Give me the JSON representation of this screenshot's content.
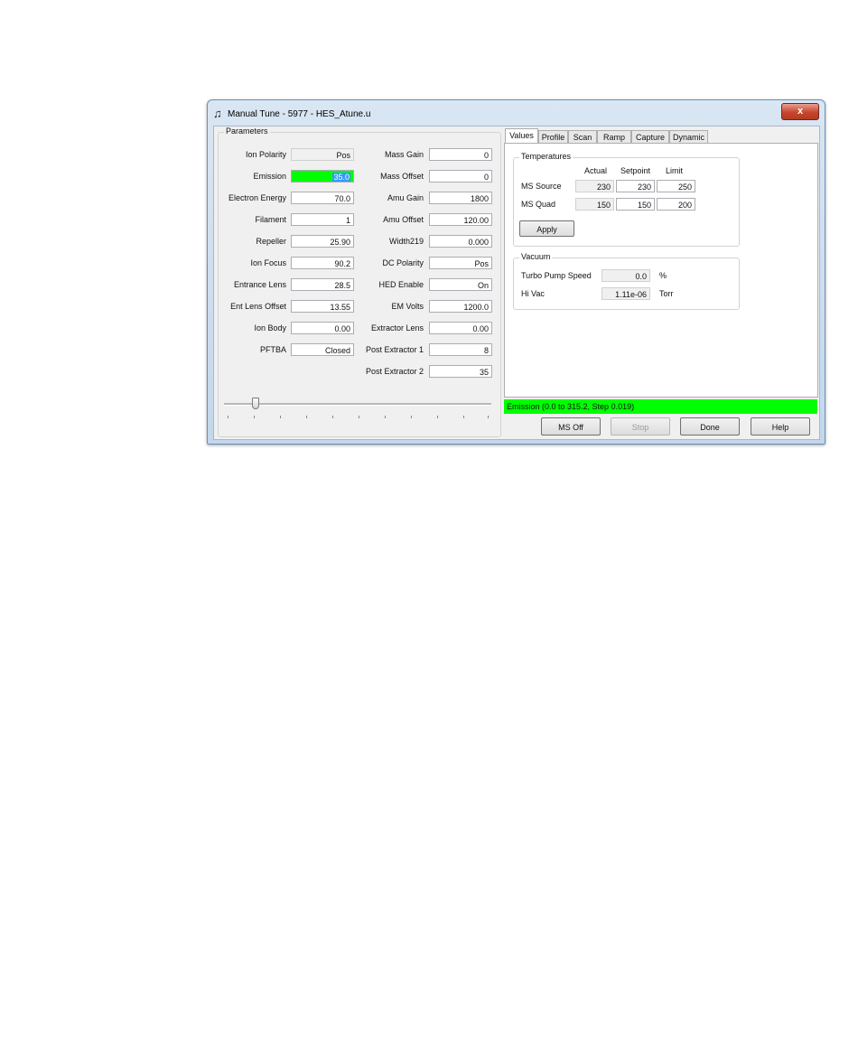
{
  "window": {
    "title": "Manual Tune - 5977 - HES_Atune.u",
    "close_glyph": "x",
    "icon": "music-note-icon"
  },
  "parameters": {
    "group_label": "Parameters",
    "left": [
      {
        "label": "Ion Polarity",
        "value": "Pos"
      },
      {
        "label": "Emission",
        "value": "35.0"
      },
      {
        "label": "Electron Energy",
        "value": "70.0"
      },
      {
        "label": "Filament",
        "value": "1"
      },
      {
        "label": "Repeller",
        "value": "25.90"
      },
      {
        "label": "Ion Focus",
        "value": "90.2"
      },
      {
        "label": "Entrance Lens",
        "value": "28.5"
      },
      {
        "label": "Ent Lens Offset",
        "value": "13.55"
      },
      {
        "label": "Ion Body",
        "value": "0.00"
      },
      {
        "label": "PFTBA",
        "value": "Closed"
      }
    ],
    "right": [
      {
        "label": "Mass Gain",
        "value": "0"
      },
      {
        "label": "Mass Offset",
        "value": "0"
      },
      {
        "label": "Amu Gain",
        "value": "1800"
      },
      {
        "label": "Amu Offset",
        "value": "120.00"
      },
      {
        "label": "Width219",
        "value": "0.000"
      },
      {
        "label": "DC Polarity",
        "value": "Pos"
      },
      {
        "label": "HED Enable",
        "value": "On"
      },
      {
        "label": "EM Volts",
        "value": "1200.0"
      },
      {
        "label": "Extractor Lens",
        "value": "0.00"
      },
      {
        "label": "Post Extractor 1",
        "value": "8"
      },
      {
        "label": "Post Extractor 2",
        "value": "35"
      }
    ]
  },
  "tabs": [
    "Values",
    "Profile",
    "Scan",
    "Ramp",
    "Capture",
    "Dynamic"
  ],
  "temperatures": {
    "group_label": "Temperatures",
    "headers": [
      "Actual",
      "Setpoint",
      "Limit"
    ],
    "rows": [
      {
        "label": "MS Source",
        "actual": "230",
        "setpoint": "230",
        "limit": "250"
      },
      {
        "label": "MS Quad",
        "actual": "150",
        "setpoint": "150",
        "limit": "200"
      }
    ],
    "apply_label": "Apply"
  },
  "vacuum": {
    "group_label": "Vacuum",
    "rows": [
      {
        "label": "Turbo Pump Speed",
        "value": "0.0",
        "unit": "%"
      },
      {
        "label": "Hi Vac",
        "value": "1.11e-06",
        "unit": "Torr"
      }
    ]
  },
  "status_text": "Emission (0.0 to 315.2, Step 0.019)",
  "buttons": {
    "ms_off": "MS Off",
    "stop": "Stop",
    "done": "Done",
    "help": "Help"
  },
  "colors": {
    "highlight_green": "#00ff00",
    "selection_blue": "#3399ff"
  }
}
